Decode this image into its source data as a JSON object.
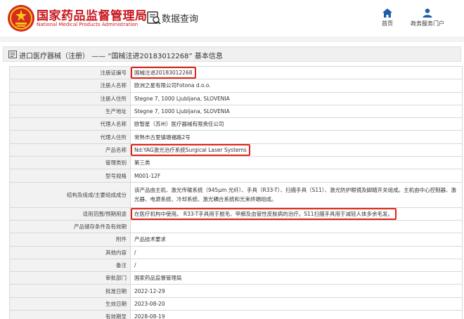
{
  "header": {
    "title": "国家药品监督管理局",
    "subtitle": "National Medical Products Administration",
    "db_label": "数据查询",
    "nav": {
      "home": "首页",
      "service": "政务服务门户"
    }
  },
  "breadcrumb": "进口医疗器械（注册） —— “国械注进20183012268” 基本信息",
  "rows": [
    {
      "label": "注册证编号",
      "value": "国械注进20183012268",
      "highlight": true
    },
    {
      "label": "注册人名称",
      "value": "欧洲之星有限公司Fotona d.o.o."
    },
    {
      "label": "注册人住所",
      "value": "Stegne 7, 1000 Ljubljana, SLOVENIA"
    },
    {
      "label": "生产地址",
      "value": "Stegne 7, 1000 Ljubljana, SLOVENIA"
    },
    {
      "label": "代理人名称",
      "value": "欧智星（苏州）医疗器械有限责任公司"
    },
    {
      "label": "代理人住所",
      "value": "常熟市古里镇塘福路2号"
    },
    {
      "label": "产品名称",
      "value": "Nd:YAG激光治疗系统Surgical Laser Systems",
      "highlight": true
    },
    {
      "label": "管理类别",
      "value": "第三类"
    },
    {
      "label": "型号规格",
      "value": "M001-12F"
    },
    {
      "label": "结构及组成/主要组成成分",
      "value": "该产品由主机、激光传输系统（945μm 光纤）、手具（R33-T）、扫描手具（S11）、激光防护眼镜及脚踏开关组成。主机由中心控制器、激光器、电源系统、冷却系统、激光耦合系统和光束终端组成。",
      "tall": true
    },
    {
      "label": "适用范围/预期用途",
      "value": "在医疗机构中使用。 R33-T手具用于脱毛、甲癣及血管性皮肤病的治疗。S11扫描手具用于减轻人体多余毛发。",
      "highlight": true
    },
    {
      "label": "产品储存条件及有效期",
      "value": ""
    },
    {
      "label": "附件",
      "value": "产品技术要求"
    },
    {
      "label": "其他内容",
      "value": "/"
    },
    {
      "label": "备注",
      "value": "/"
    },
    {
      "label": "审批部门",
      "value": "国家药品监督管理局"
    },
    {
      "label": "批准日期",
      "value": "2022-12-29"
    },
    {
      "label": "生效日期",
      "value": "2023-08-20"
    },
    {
      "label": "有效期至",
      "value": "2028-08-19"
    }
  ],
  "colors": {
    "brand_red": "#c8161e",
    "highlight_box": "#e2231a",
    "nav_blue": "#1f5fa8"
  }
}
